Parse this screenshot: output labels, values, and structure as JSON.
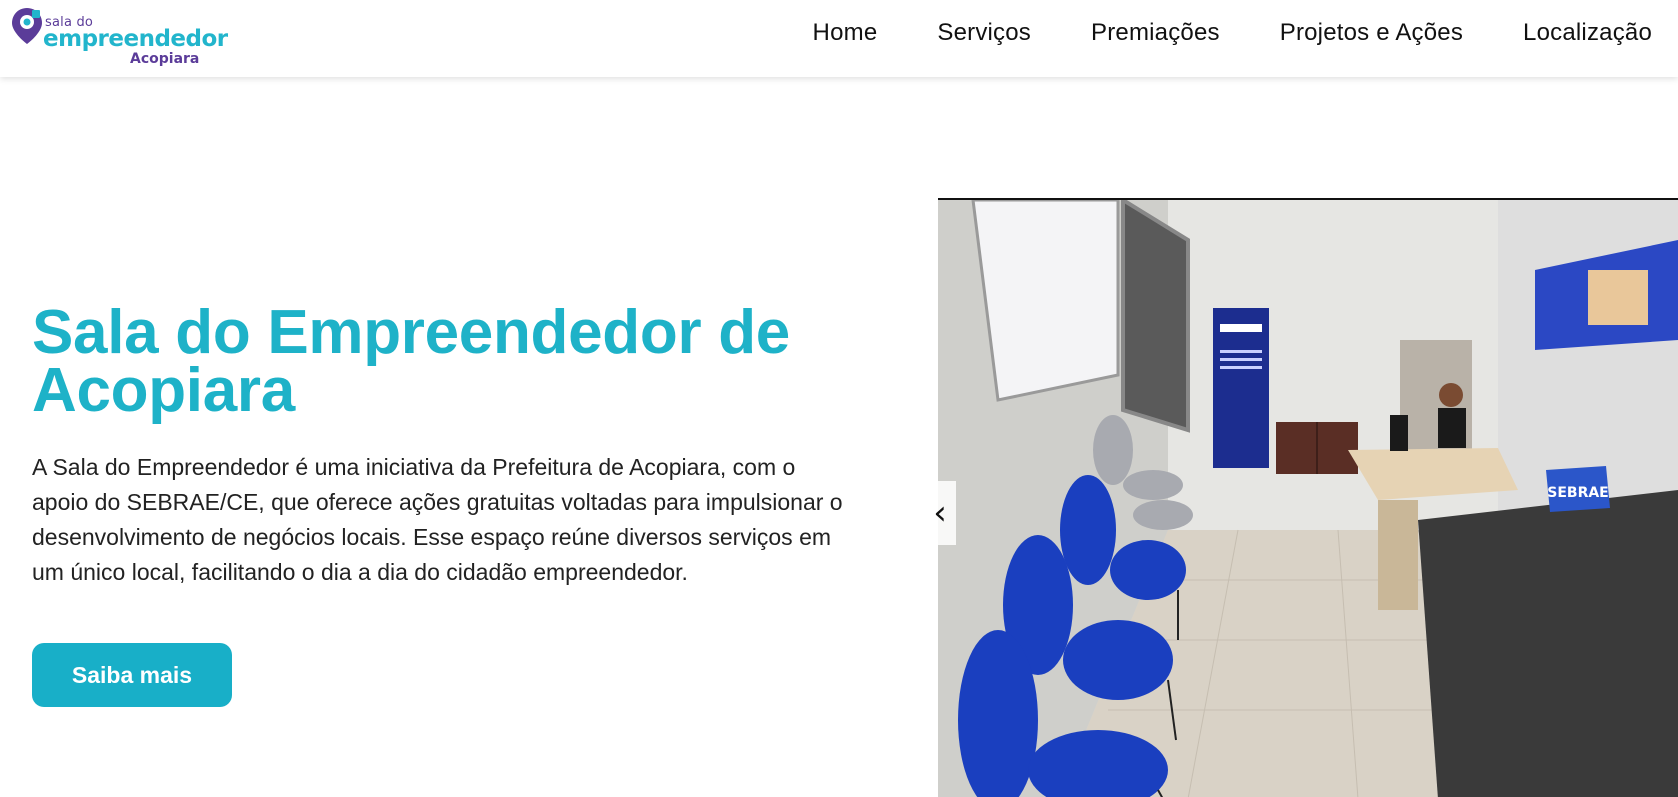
{
  "header": {
    "logo": {
      "small_text": "sala do",
      "main_text": "empreendedor",
      "city_text": "Acopiara"
    },
    "nav": [
      "Home",
      "Serviços",
      "Premiações",
      "Projetos e Ações",
      "Localização"
    ]
  },
  "hero": {
    "title_line1": "Sala do Empreendedor de",
    "title_line2": "Acopiara",
    "description": "A Sala do Empreendedor é uma iniciativa da Prefeitura de Acopiara, com o apoio do SEBRAE/CE, que oferece ações gratuitas voltadas para impulsionar o desenvolvimento de negócios locais. Esse espaço reúne diversos serviços em um único local, facilitando o dia a dia do cidadão empreendedor.",
    "cta_label": "Saiba mais"
  },
  "carousel": {
    "prev_glyph": "‹",
    "photo_text": "SEBRAE"
  },
  "colors": {
    "accent": "#1eb2c8",
    "brand_purple": "#5b3c99",
    "chair_blue": "#1a3fbf"
  }
}
